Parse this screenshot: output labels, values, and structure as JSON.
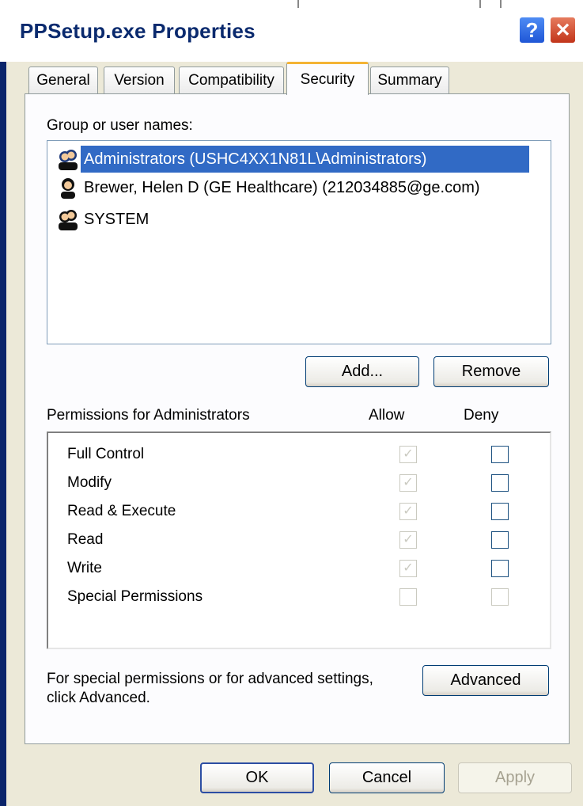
{
  "window": {
    "title": "PPSetup.exe Properties",
    "help_glyph": "?",
    "close_glyph": "✕"
  },
  "tabs": [
    {
      "label": "General"
    },
    {
      "label": "Version"
    },
    {
      "label": "Compatibility"
    },
    {
      "label": "Security",
      "active": true
    },
    {
      "label": "Summary"
    }
  ],
  "security": {
    "group_label": "Group or user names:",
    "users": [
      {
        "name": "Administrators (USHC4XX1N81L\\Administrators)",
        "icon": "group-icon",
        "selected": true
      },
      {
        "name": "Brewer, Helen D (GE Healthcare) (212034885@ge.com)",
        "icon": "user-icon",
        "selected": false
      },
      {
        "name": "SYSTEM",
        "icon": "group-icon",
        "selected": false
      }
    ],
    "add_label": "Add...",
    "remove_label": "Remove",
    "permissions_label": "Permissions for Administrators",
    "allow_header": "Allow",
    "deny_header": "Deny",
    "permissions": [
      {
        "name": "Full Control",
        "allow": true,
        "deny": false
      },
      {
        "name": "Modify",
        "allow": true,
        "deny": false
      },
      {
        "name": "Read & Execute",
        "allow": true,
        "deny": false
      },
      {
        "name": "Read",
        "allow": true,
        "deny": false
      },
      {
        "name": "Write",
        "allow": true,
        "deny": false
      },
      {
        "name": "Special Permissions",
        "allow": false,
        "deny": false
      }
    ],
    "advanced_note_line1": "For special permissions or for advanced settings,",
    "advanced_note_line2": "click Advanced.",
    "advanced_label": "Advanced"
  },
  "footer": {
    "ok_label": "OK",
    "cancel_label": "Cancel",
    "apply_label": "Apply"
  },
  "colors": {
    "selection": "#316ac5",
    "dialog_bg": "#ece9d8",
    "active_tab_accent": "#f4b334",
    "title_text": "#0a2a6e"
  }
}
